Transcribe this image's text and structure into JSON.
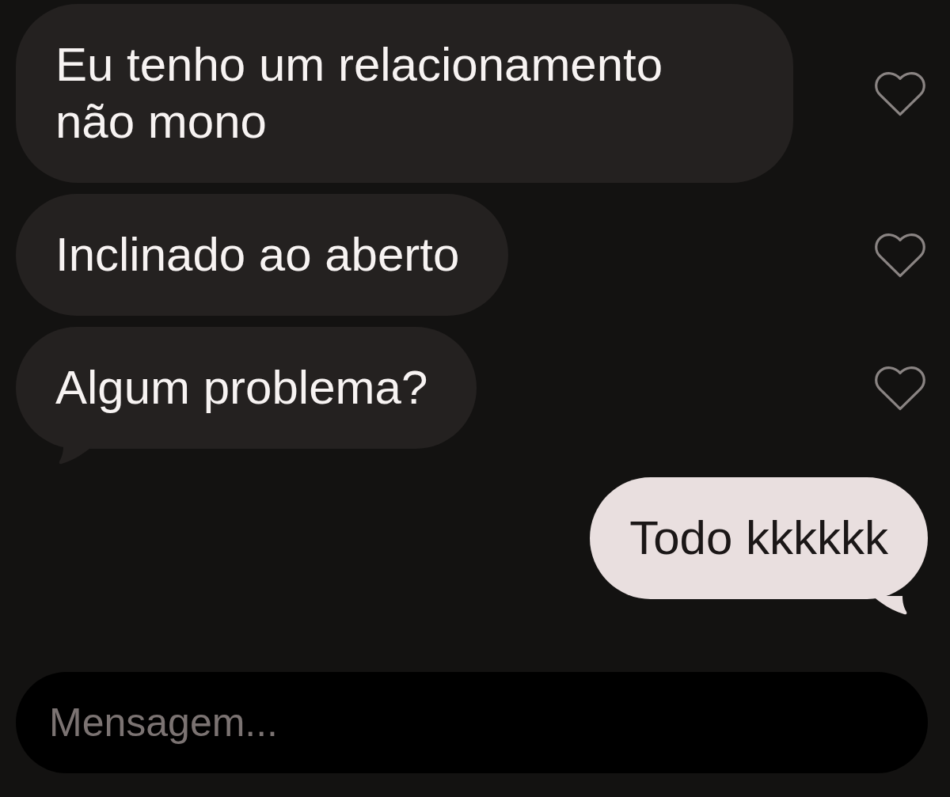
{
  "messages": [
    {
      "kind": "received",
      "text": "Eu tenho um relacionamento não mono",
      "tail": false,
      "liked": false
    },
    {
      "kind": "received",
      "text": "Inclinado ao aberto",
      "tail": false,
      "liked": false
    },
    {
      "kind": "received",
      "text": "Algum problema?",
      "tail": true,
      "liked": false
    },
    {
      "kind": "sent",
      "text": "Todo kkkkkk",
      "tail": true
    }
  ],
  "composer": {
    "placeholder": "Mensagem..."
  }
}
